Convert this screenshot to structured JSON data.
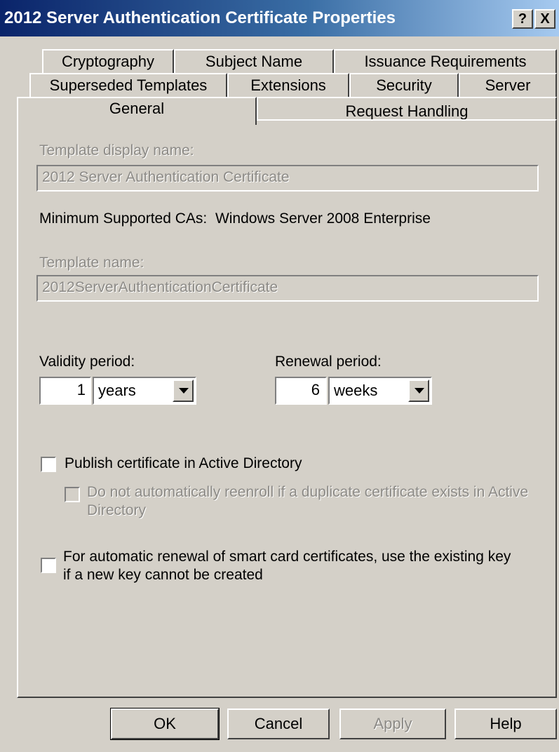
{
  "window": {
    "title": "2012 Server Authentication Certificate Properties",
    "help_button": "?",
    "close_button": "X"
  },
  "tabs": {
    "row1": [
      "Cryptography",
      "Subject Name",
      "Issuance Requirements"
    ],
    "row2": [
      "Superseded Templates",
      "Extensions",
      "Security",
      "Server"
    ],
    "row3": [
      "General",
      "Request Handling"
    ],
    "selected": "General"
  },
  "general": {
    "display_name_label": "Template display name:",
    "display_name_value": "2012 Server Authentication Certificate",
    "min_ca_label": "Minimum Supported CAs:",
    "min_ca_value": "Windows Server 2008 Enterprise",
    "template_name_label": "Template name:",
    "template_name_value": "2012ServerAuthenticationCertificate",
    "validity_label": "Validity period:",
    "validity_value": "1",
    "validity_unit": "years",
    "renewal_label": "Renewal period:",
    "renewal_value": "6",
    "renewal_unit": "weeks",
    "publish_label": "Publish certificate in Active Directory",
    "publish_checked": false,
    "no_reenroll_label_line1": "Do not automatically reenroll if a duplicate certificate exists in Active",
    "no_reenroll_label_line2": "Directory",
    "no_reenroll_checked": false,
    "smartcard_label_line1": "For automatic renewal of smart card certificates, use the existing key",
    "smartcard_label_line2": "if a new key cannot be created",
    "smartcard_checked": false
  },
  "buttons": {
    "ok": "OK",
    "cancel": "Cancel",
    "apply": "Apply",
    "help": "Help"
  }
}
